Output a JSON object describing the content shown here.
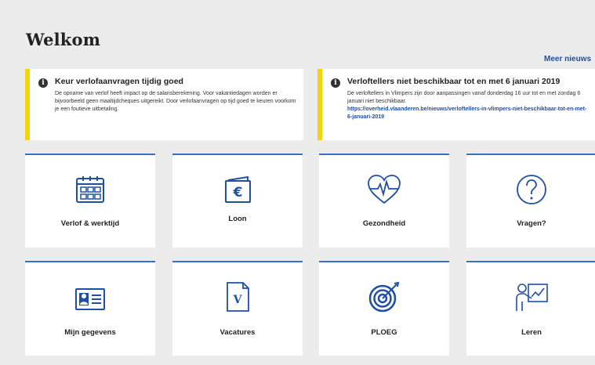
{
  "page": {
    "title": "Welkom",
    "more_news": "Meer nieuws →"
  },
  "notices": [
    {
      "title": "Keur verlofaanvragen tijdig goed",
      "body": "De opname van verlof heeft impact op de salarisberekening. Voor vakantiedagen worden er bijvoorbeeld geen maaltijdcheques uitgereikt. Door verlofaanvragen op tijd goed te keuren voorkom je een foutieve uitbetaling.",
      "link": ""
    },
    {
      "title": "Verloftellers niet beschikbaar tot en met 6 januari 2019",
      "body": "De verloftellers in Vlimpers zijn door aanpassingen vanaf donderdag 16 uur tot en met zondag 6 januari niet beschikbaar.",
      "link": "https://overheid.vlaanderen.be/nieuws/verloftellers-in-vlimpers-niet-beschikbaar-tot-en-met-6-januari-2019"
    }
  ],
  "tiles": [
    {
      "label": "Verlof & werktijd",
      "icon": "calendar-icon"
    },
    {
      "label": "Loon",
      "icon": "wallet-euro-icon"
    },
    {
      "label": "Gezondheid",
      "icon": "heart-pulse-icon"
    },
    {
      "label": "Vragen?",
      "icon": "question-icon"
    },
    {
      "label": "Mijn gegevens",
      "icon": "id-card-icon"
    },
    {
      "label": "Vacatures",
      "icon": "document-v-icon"
    },
    {
      "label": "PLOEG",
      "icon": "target-icon"
    },
    {
      "label": "Leren",
      "icon": "teacher-board-icon"
    }
  ],
  "colors": {
    "accent": "#1f4fa3",
    "warning": "#f5d40f",
    "tile_border": "#3a6fc4"
  }
}
